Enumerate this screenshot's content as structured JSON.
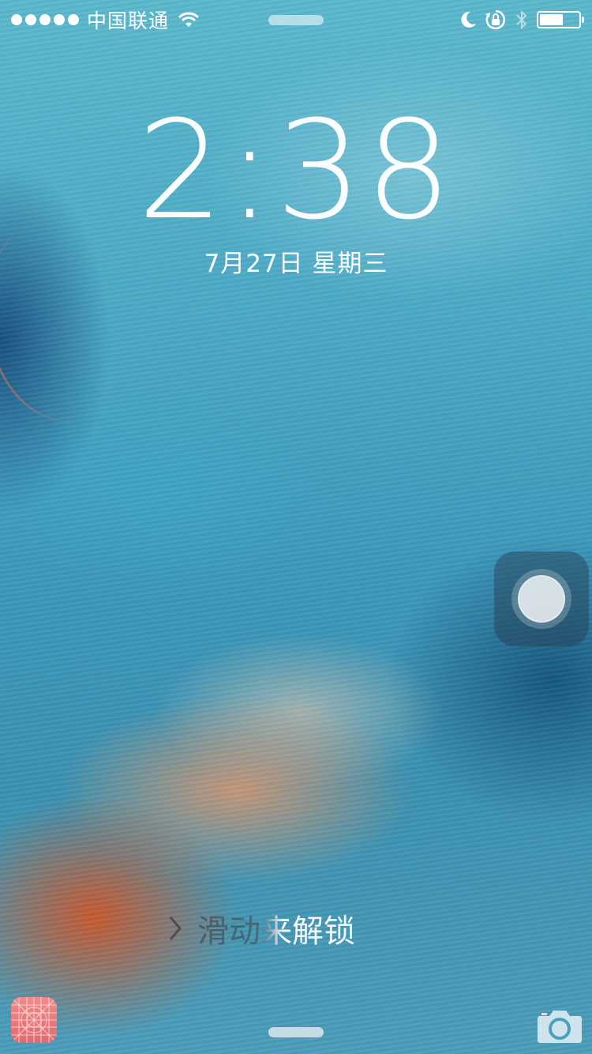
{
  "status_bar": {
    "carrier": "中国联通",
    "signal_dots": 5,
    "icons": [
      "wifi-icon",
      "moon-icon",
      "rotation-lock-icon",
      "bluetooth-icon",
      "battery-icon"
    ],
    "battery_level": 0.6
  },
  "lock_screen": {
    "time": "2:38",
    "date": "7月27日 星期三",
    "unlock_text": "滑动来解锁"
  },
  "bottom": {
    "left_icon": "app-icon",
    "right_icon": "camera-icon"
  },
  "colors": {
    "accent_text": "#ffffff",
    "wallpaper_primary": "#4aa8c4",
    "wallpaper_warm": "#cd5528"
  }
}
